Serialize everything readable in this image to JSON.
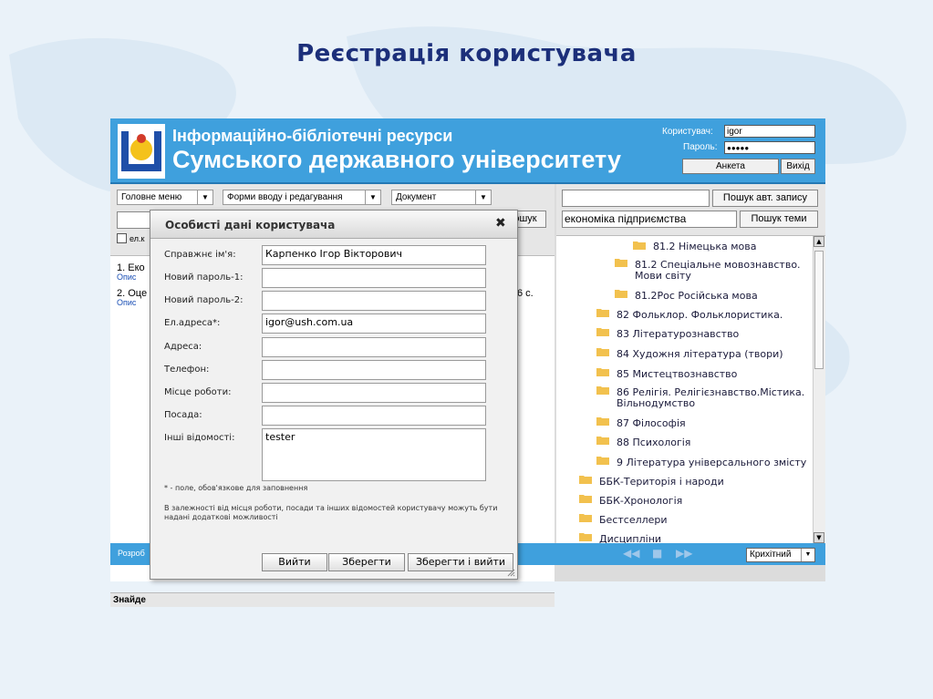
{
  "slide": {
    "title": "Реєстрація  користувача"
  },
  "header": {
    "line1": "Інформаційно-бібліотечні ресурси",
    "line2": "Сумського державного університету",
    "user_label": "Користувач:",
    "user_value": "igor",
    "password_label": "Пароль:",
    "password_value": "●●●●●",
    "profile_button": "Анкета",
    "exit_button": "Вихід"
  },
  "toolbar": {
    "menu1": "Головне меню",
    "menu2": "Форми вводу і редагування",
    "menu3": "Документ",
    "search_button_left": "ошук",
    "checkbox_label": "ел.к"
  },
  "results": [
    {
      "num": "1. Еко",
      "link": "Опис"
    },
    {
      "num": "2. Оце",
      "link": "Опис",
      "tail": "6 с."
    }
  ],
  "found_label": "Знайде",
  "bottom_label": "Розроб",
  "right": {
    "author_query": "",
    "author_button": "Пошук авт. запису",
    "topic_query": "економіка підприємства",
    "topic_button": "Пошук теми",
    "tree": [
      {
        "text": "81.2 Німецька мова"
      },
      {
        "text": "81.2 Спеціальне мовознавство. Мови світу"
      },
      {
        "text": "81.2Рос Російська мова"
      },
      {
        "text": "82 Фольклор. Фольклористика."
      },
      {
        "text": "83 Літературознавство"
      },
      {
        "text": "84 Художня література (твори)"
      },
      {
        "text": "85 Мистецтвознавство"
      },
      {
        "text": "86 Релігія. Релігієзнавство.Містика. Вільнодумство"
      },
      {
        "text": "87 Філософія"
      },
      {
        "text": "88 Психологія"
      },
      {
        "text": "9 Література універсального змісту"
      },
      {
        "text": "ББК-Територія і народи"
      },
      {
        "text": "ББК-Хронологія"
      },
      {
        "text": "Бестселлери"
      },
      {
        "text": "Дисципліни"
      }
    ],
    "language": "Крихітний"
  },
  "modal": {
    "title": "Особисті дані користувача",
    "fields": {
      "realname_label": "Справжнє ім'я:",
      "realname_value": "Карпенко Ігор Вікторович",
      "newpass1_label": "Новий пароль-1:",
      "newpass2_label": "Новий пароль-2:",
      "email_label": "Ел.адреса*:",
      "email_value": "igor@ush.com.ua",
      "address_label": "Адреса:",
      "phone_label": "Телефон:",
      "work_label": "Місце роботи:",
      "position_label": "Посада:",
      "other_label": "Інші відомості:",
      "other_value": "tester"
    },
    "note1": "* - поле, обов'язкове для заповнення",
    "note2": "В залежності від місця роботи, посади та інших відомостей користувачу можуть бути надані додаткові можливості",
    "buttons": {
      "exit": "Вийти",
      "save": "Зберегти",
      "save_exit": "Зберегти і вийти"
    }
  },
  "colors": {
    "header_blue": "#3fa0dd",
    "title_navy": "#1c2f7a",
    "link_blue": "#1a4fb5"
  }
}
